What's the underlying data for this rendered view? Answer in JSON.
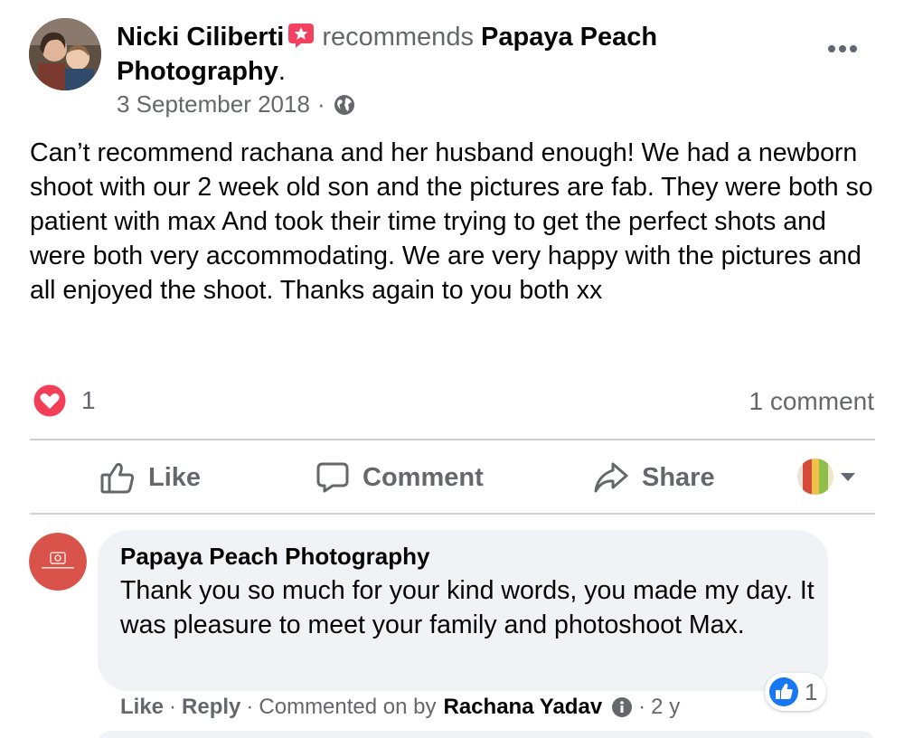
{
  "post": {
    "author": "Nicki Ciliberti",
    "recommends_text": "recommends",
    "page_name_line1": "Papaya Peach",
    "page_name_line2": "Photography",
    "period": ".",
    "date": "3 September 2018",
    "meta_separator": "·",
    "body": "Can’t recommend rachana and her husband enough! We had a newborn shoot with our 2 week old son and the pictures are fab. They were both so patient with max And took their time trying to get the perfect shots and were both very accommodating. We are very happy with the pictures and all enjoyed the shoot. Thanks again to you both xx",
    "reaction_count": "1",
    "comment_count": "1 comment"
  },
  "actions": {
    "like": "Like",
    "comment": "Comment",
    "share": "Share"
  },
  "comment": {
    "author": "Papaya Peach Photography",
    "text": "Thank you so much for your kind words, you made my day. It was pleasure to meet your family and photoshoot Max.",
    "like_count": "1",
    "like_action": "Like",
    "reply_action": "Reply",
    "separator": "·",
    "commented_on_by": "Commented on by",
    "commented_by_name": "Rachana Yadav",
    "age": "2 y"
  },
  "colors": {
    "text": "#050505",
    "secondary": "#65676b",
    "love": "#f33e58",
    "like_blue": "#1877f2",
    "star_badge": "#f3425f",
    "bubble": "#f0f2f5",
    "brand_red": "#d9534a"
  },
  "icons": [
    "star-badge-icon",
    "globe-icon",
    "more-icon",
    "love-icon",
    "like-icon",
    "comment-icon",
    "share-icon",
    "chevron-down-icon",
    "like-reaction-icon",
    "info-icon"
  ]
}
